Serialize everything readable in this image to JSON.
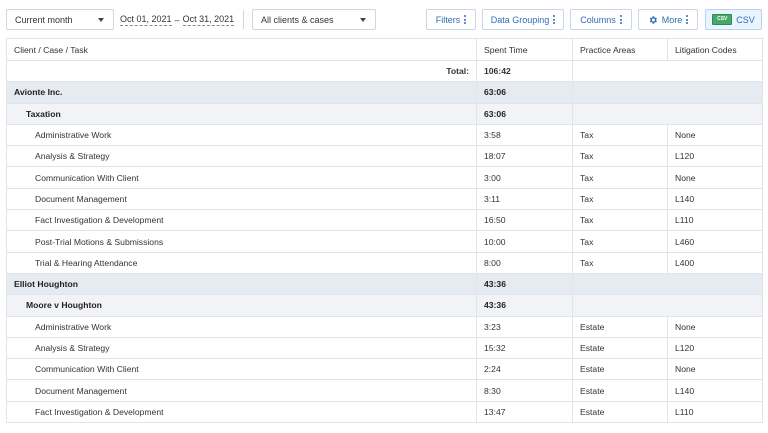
{
  "toolbar": {
    "period_select": "Current month",
    "date_start": "Oct 01, 2021",
    "date_sep": "–",
    "date_end": "Oct 31, 2021",
    "clients_select": "All clients & cases",
    "filters_label": "Filters",
    "grouping_label": "Data Grouping",
    "columns_label": "Columns",
    "more_label": "More",
    "csv_label": "CSV",
    "csv_icon_text": "CSV"
  },
  "table": {
    "headers": [
      "Client / Case / Task",
      "Spent Time",
      "Practice Areas",
      "Litigation Codes"
    ],
    "total_label": "Total:",
    "total_value": "106:42",
    "groups": [
      {
        "client": "Avionte Inc.",
        "client_time": "63:06",
        "case": "Taxation",
        "case_time": "63:06",
        "tasks": [
          {
            "task": "Administrative Work",
            "time": "3:58",
            "area": "Tax",
            "code": "None"
          },
          {
            "task": "Analysis & Strategy",
            "time": "18:07",
            "area": "Tax",
            "code": "L120"
          },
          {
            "task": "Communication With Client",
            "time": "3:00",
            "area": "Tax",
            "code": "None"
          },
          {
            "task": "Document Management",
            "time": "3:11",
            "area": "Tax",
            "code": "L140"
          },
          {
            "task": "Fact Investigation & Development",
            "time": "16:50",
            "area": "Tax",
            "code": "L110"
          },
          {
            "task": "Post-Trial Motions & Submissions",
            "time": "10:00",
            "area": "Tax",
            "code": "L460"
          },
          {
            "task": "Trial & Hearing Attendance",
            "time": "8:00",
            "area": "Tax",
            "code": "L400"
          }
        ]
      },
      {
        "client": "Elliot Houghton",
        "client_time": "43:36",
        "case": "Moore v Houghton",
        "case_time": "43:36",
        "tasks": [
          {
            "task": "Administrative Work",
            "time": "3:23",
            "area": "Estate",
            "code": "None"
          },
          {
            "task": "Analysis & Strategy",
            "time": "15:32",
            "area": "Estate",
            "code": "L120"
          },
          {
            "task": "Communication With Client",
            "time": "2:24",
            "area": "Estate",
            "code": "None"
          },
          {
            "task": "Document Management",
            "time": "8:30",
            "area": "Estate",
            "code": "L140"
          },
          {
            "task": "Fact Investigation & Development",
            "time": "13:47",
            "area": "Estate",
            "code": "L110"
          }
        ]
      }
    ]
  }
}
